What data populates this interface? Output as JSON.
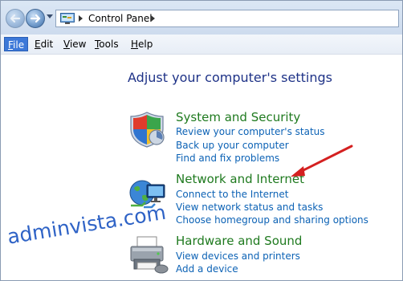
{
  "address_bar": {
    "breadcrumb": "Control Panel"
  },
  "menu": {
    "items": [
      {
        "pre": "",
        "accel": "F",
        "post": "ile"
      },
      {
        "pre": "",
        "accel": "E",
        "post": "dit"
      },
      {
        "pre": "",
        "accel": "V",
        "post": "iew"
      },
      {
        "pre": "",
        "accel": "T",
        "post": "ools"
      },
      {
        "pre": "",
        "accel": "H",
        "post": "elp"
      }
    ]
  },
  "main": {
    "heading": "Adjust your computer's settings",
    "categories": [
      {
        "title": "System and Security",
        "icon": "shield-icon",
        "links": [
          "Review your computer's status",
          "Back up your computer",
          "Find and fix problems"
        ]
      },
      {
        "title": "Network and Internet",
        "icon": "network-globe-icon",
        "links": [
          "Connect to the Internet",
          "View network status and tasks",
          "Choose homegroup and sharing options"
        ]
      },
      {
        "title": "Hardware and Sound",
        "icon": "printer-icon",
        "links": [
          "View devices and printers",
          "Add a device"
        ]
      }
    ]
  },
  "watermark": "adminvista.com",
  "colors": {
    "heading": "#1e3287",
    "category_title": "#1f7a1f",
    "link": "#0c62b5",
    "annotation_arrow": "#d42020",
    "watermark": "#2f63c6"
  }
}
